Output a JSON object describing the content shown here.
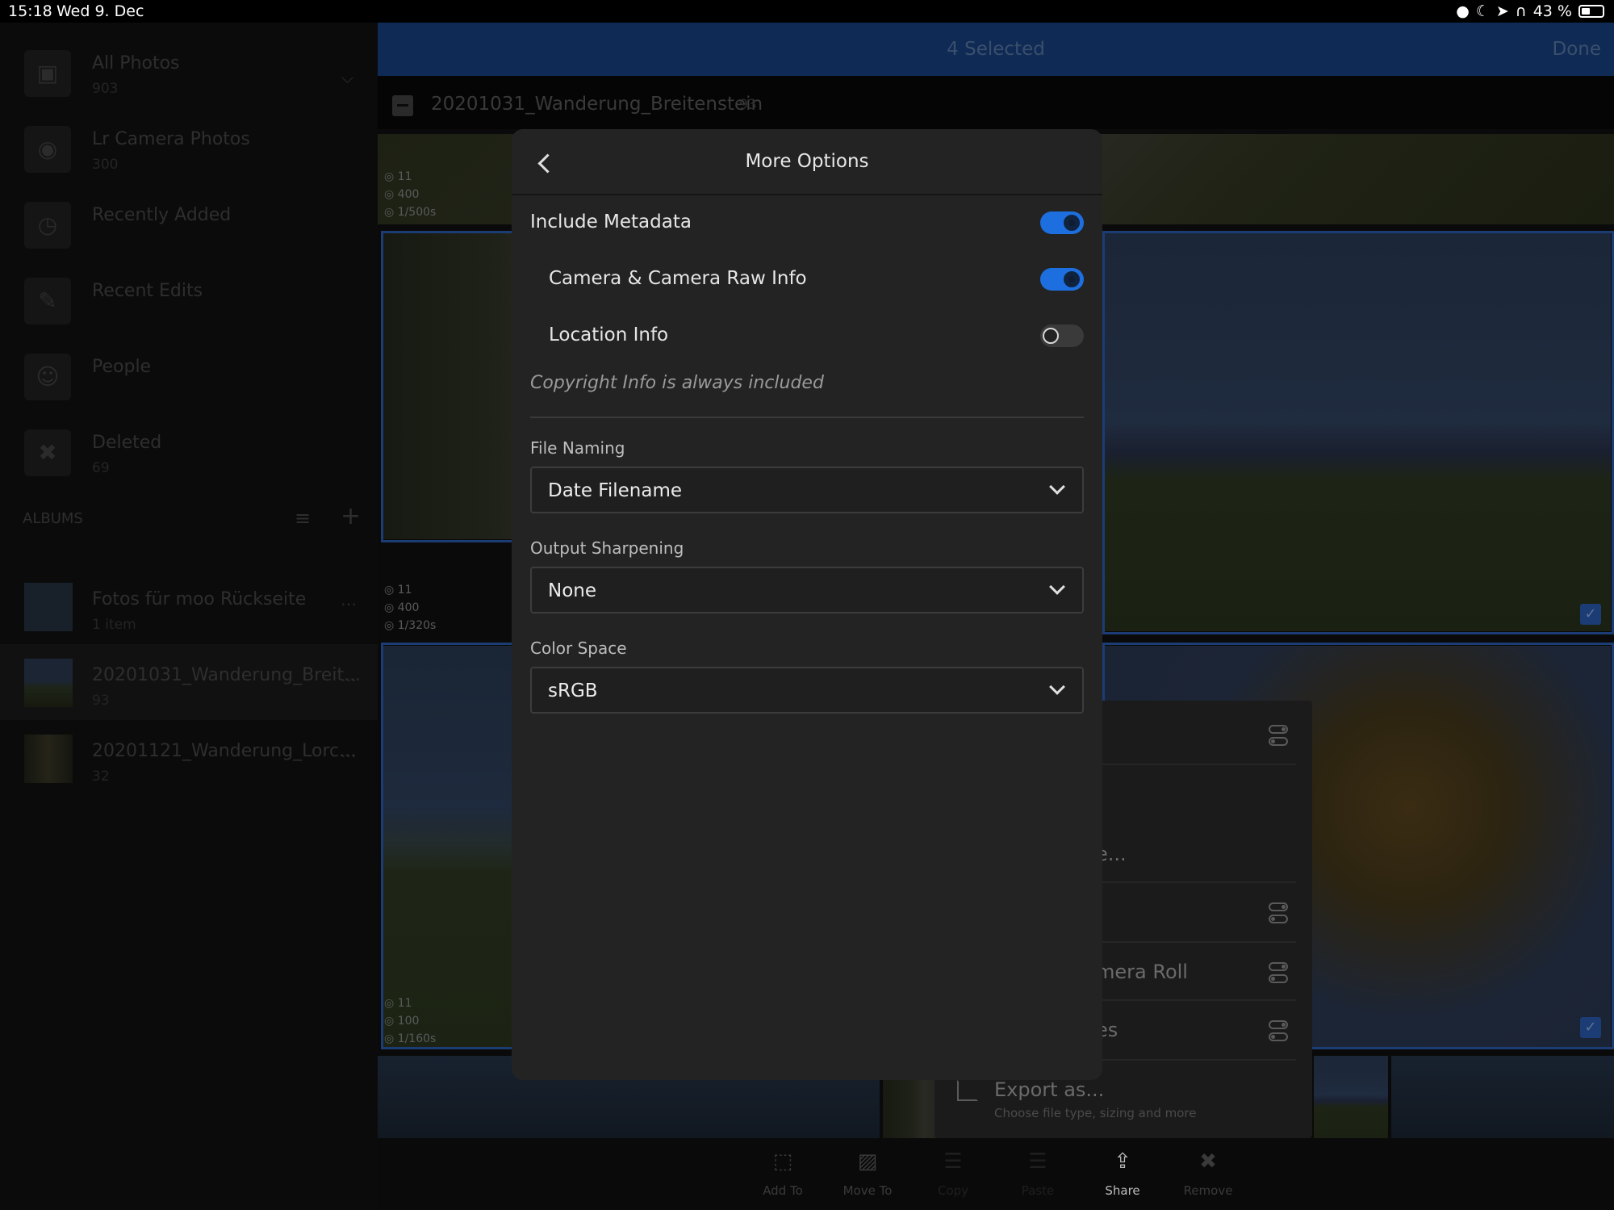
{
  "status_bar": {
    "time": "15:18",
    "date": "Wed 9. Dec",
    "battery": "43 %"
  },
  "sidebar": {
    "items": [
      {
        "label": "All Photos",
        "count": "903",
        "icon": "photos-icon"
      },
      {
        "label": "Lr Camera Photos",
        "count": "300",
        "icon": "camera-icon"
      },
      {
        "label": "Recently Added",
        "count": "",
        "icon": "clock-icon"
      },
      {
        "label": "Recent Edits",
        "count": "",
        "icon": "edit-icon"
      },
      {
        "label": "People",
        "count": "",
        "icon": "person-icon"
      },
      {
        "label": "Deleted",
        "count": "69",
        "icon": "trash-icon"
      }
    ],
    "albums_header": "ALBUMS",
    "albums": [
      {
        "label": "Fotos für moo Rückseite",
        "count": "1 item"
      },
      {
        "label": "20201031_Wanderung_Breit...",
        "count": "93"
      },
      {
        "label": "20201121_Wanderung_Lorc...",
        "count": "32"
      }
    ]
  },
  "topbar": {
    "title": "4 Selected",
    "done_label": "Done"
  },
  "folder": {
    "name": "20201031_Wanderung_Breitenstein",
    "count": "93"
  },
  "exif": [
    {
      "aperture": "11",
      "iso": "400",
      "shutter": "1/500s"
    },
    {
      "aperture": "11",
      "iso": "400",
      "shutter": "1/320s"
    },
    {
      "aperture": "11",
      "iso": "100",
      "shutter": "1/160s"
    }
  ],
  "share_sheet": {
    "partial_1": "e...",
    "partial_2": "mera Roll",
    "partial_3": "es",
    "export_label": "Export as...",
    "export_sub": "Choose file type, sizing and more"
  },
  "toolbar": {
    "items": [
      {
        "label": "Add To",
        "icon": "add-to-icon"
      },
      {
        "label": "Move To",
        "icon": "move-to-icon"
      },
      {
        "label": "Copy",
        "icon": "copy-icon"
      },
      {
        "label": "Paste",
        "icon": "paste-icon"
      },
      {
        "label": "Share",
        "icon": "share-icon"
      },
      {
        "label": "Remove",
        "icon": "trash-icon"
      }
    ]
  },
  "modal": {
    "title": "More Options",
    "include_metadata": {
      "label": "Include Metadata",
      "on": true
    },
    "camera_raw_info": {
      "label": "Camera & Camera Raw Info",
      "on": true
    },
    "location_info": {
      "label": "Location Info",
      "on": false
    },
    "note": "Copyright Info is always included",
    "file_naming": {
      "label": "File Naming",
      "value": "Date Filename"
    },
    "output_sharpening": {
      "label": "Output Sharpening",
      "value": "None"
    },
    "color_space": {
      "label": "Color Space",
      "value": "sRGB"
    }
  },
  "colors": {
    "accent": "#1d6fe0",
    "modal_bg": "#232323",
    "topbar_bg": "#0e2a55"
  }
}
